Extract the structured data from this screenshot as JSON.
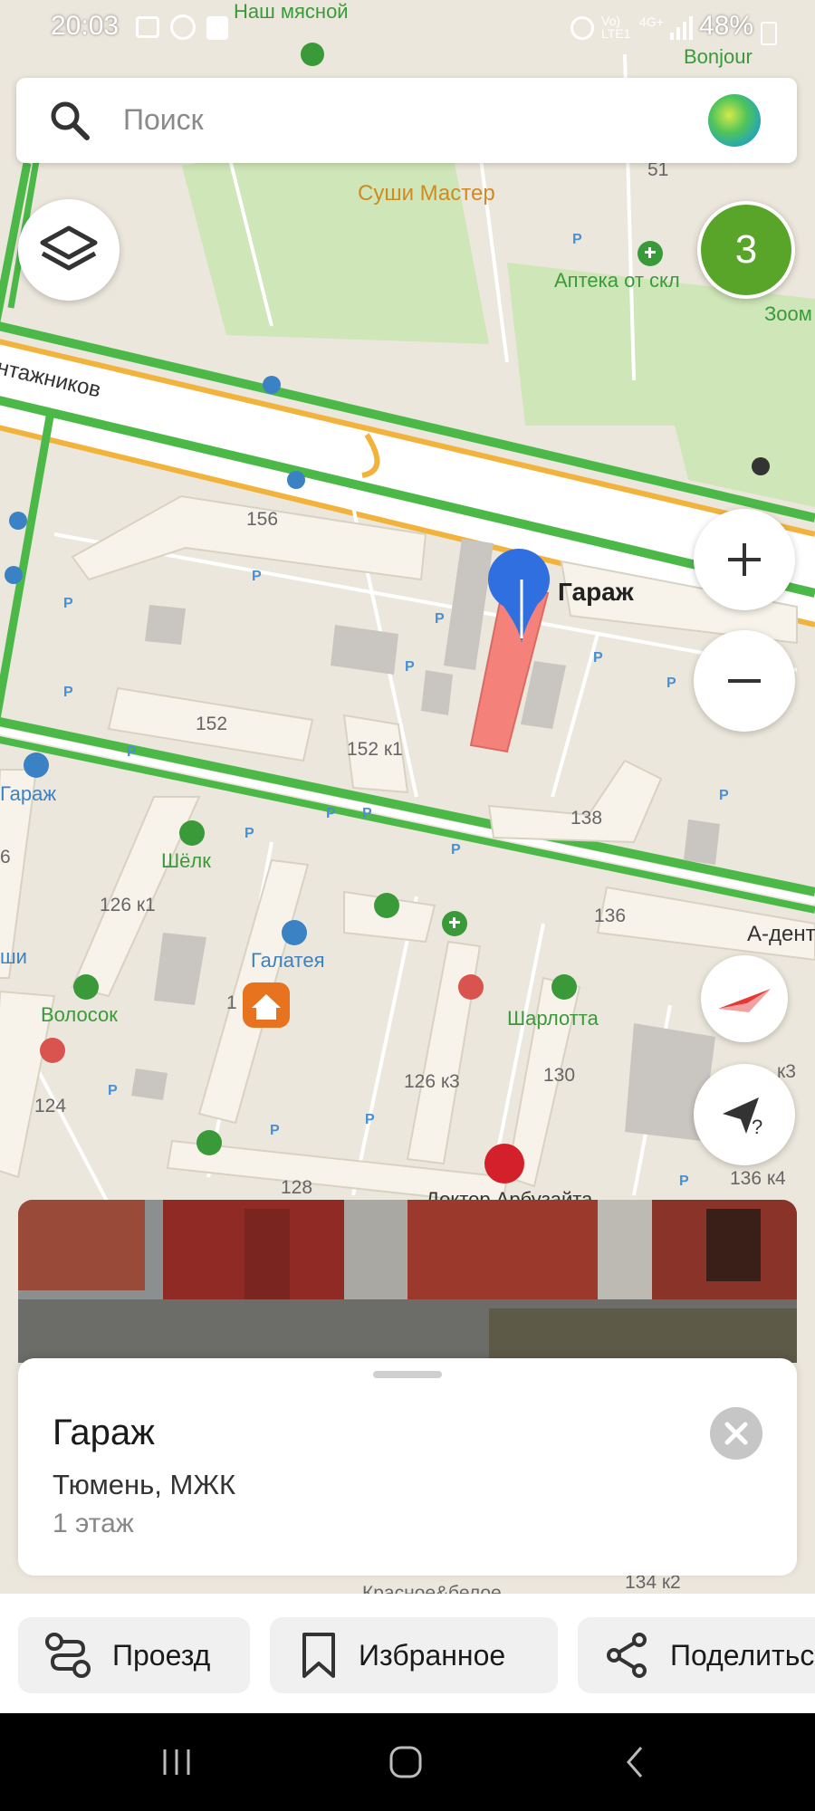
{
  "status_bar": {
    "time": "20:03",
    "battery": "48%"
  },
  "search": {
    "placeholder": "Поиск"
  },
  "map": {
    "labels": {
      "nash_myasnoy": "Наш мясной",
      "bonjour": "Bonjour",
      "sushi": "Суши Мастер",
      "num_51": "51",
      "apteka": "Аптека от скл",
      "zoom": "Зоом",
      "street": "нтажников",
      "num_156": "156",
      "garage_pin": "Гараж",
      "num_152": "152",
      "num_152k1": "152 к1",
      "garage_left": "Гараж",
      "num_138": "138",
      "shelk": "Шёлк",
      "num_126k1": "126 к1",
      "num_136": "136",
      "a_dent": "А-дент",
      "galateya": "Галатея",
      "shi": "ши",
      "volosok": "Волосок",
      "sharlotta": "Шарлотта",
      "num_126k3": "126 к3",
      "num_130": "130",
      "num_124": "124",
      "num_128": "128",
      "doktor": "Доктор Арбузайта",
      "num_136k4": "136 к4",
      "num_6": "6",
      "num_1": "1",
      "num_134k2": "134 к2",
      "krasnoe": "Красное&белое",
      "k3": "к3",
      "parking": "P"
    },
    "cluster_count": "3"
  },
  "place_card": {
    "title": "Гараж",
    "address": "Тюмень, МЖК",
    "floor": "1 этаж"
  },
  "actions": {
    "route": "Проезд",
    "favorite": "Избранное",
    "share": "Поделиться"
  },
  "colors": {
    "traffic_green": "#4cb848",
    "road_yellow": "#f2b33d",
    "pin_blue": "#2f6fe0",
    "building_highlight": "#f4827a",
    "cluster_green": "#59a52a",
    "orange_poi": "#e8731e"
  }
}
